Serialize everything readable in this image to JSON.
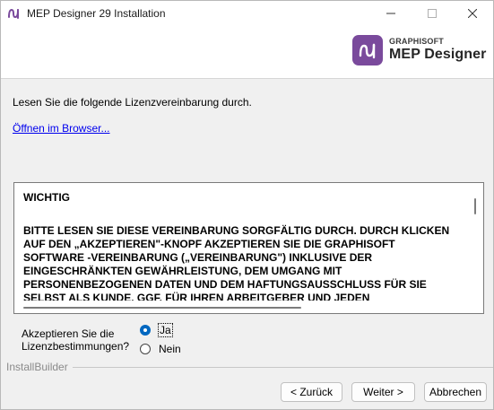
{
  "window": {
    "title": "MEP Designer 29 Installation",
    "app_icon": "mep-designer-icon",
    "controls": {
      "minimize": "—",
      "maximize": "☐",
      "close": "✕"
    }
  },
  "header": {
    "logo_icon": "mep-designer-logo-icon",
    "brand_small": "GRAPHISOFT",
    "brand_big": "MEP Designer",
    "logo_color": "#7a4a9c"
  },
  "main": {
    "instruction": "Lesen Sie die folgende Lizenzvereinbarung durch.",
    "open_browser_link": "Öffnen im Browser...",
    "license": {
      "heading": "WICHTIG",
      "lines": [
        "BITTE LESEN SIE DIESE VEREINBARUNG SORGFÄLTIG DURCH. DURCH KLICKEN",
        "AUF DEN „AKZEPTIEREN\"-KNOPF AKZEPTIEREN SIE DIE GRAPHISOFT",
        "SOFTWARE -VEREINBARUNG („VEREINBARUNG\") INKLUSIVE DER",
        "EINGESCHRÄNKTEN GEWÄHRLEISTUNG, DEM UMGANG MIT",
        "PERSONENBEZOGENEN DATEN UND DEM HAFTUNGSAUSSCHLUSS FÜR SIE",
        "SELBST ALS KUNDE, GGF. FÜR IHREN ARBEITGEBER UND JEDEN"
      ]
    },
    "accept": {
      "label_line1": "Akzeptieren Sie die",
      "label_line2": "Lizenzbestimmungen?",
      "options": [
        {
          "label": "Ja",
          "selected": true
        },
        {
          "label": "Nein",
          "selected": false
        }
      ]
    }
  },
  "footer": {
    "brand": "InstallBuilder",
    "buttons": {
      "back": "< Zurück",
      "next": "Weiter >",
      "cancel": "Abbrechen"
    }
  },
  "colors": {
    "accent": "#0067c0",
    "link": "#0000ee",
    "background": "#f0f0f0"
  }
}
